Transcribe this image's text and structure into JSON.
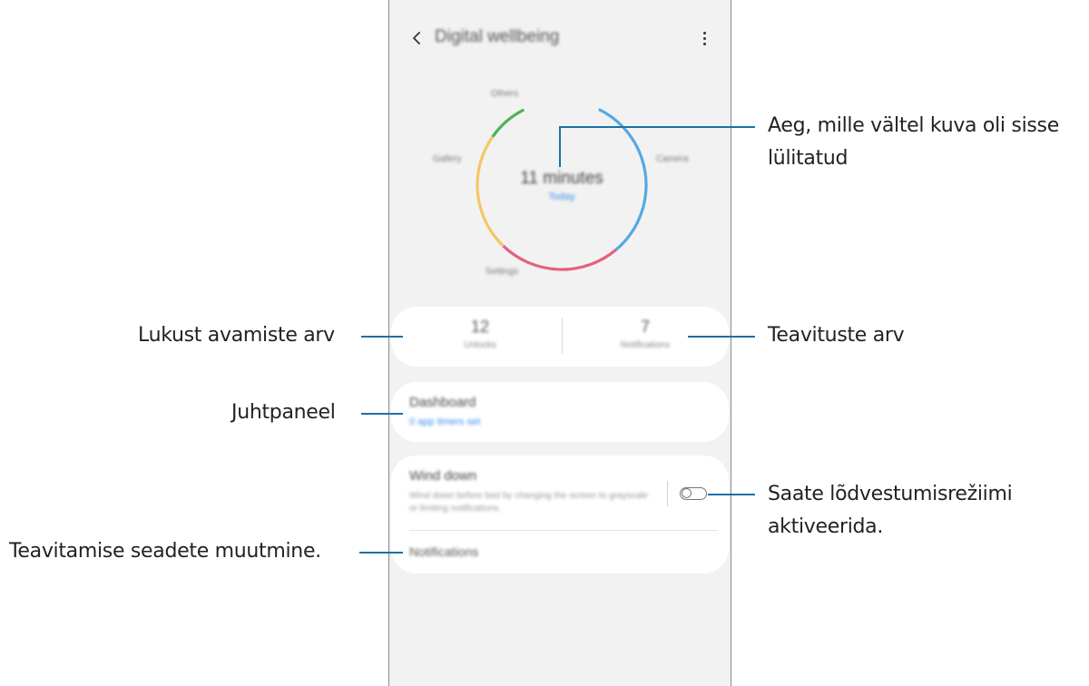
{
  "app": {
    "title": "Digital wellbeing",
    "back_icon": "back-arrow-icon",
    "more_icon": "more-vert-icon"
  },
  "screen_time": {
    "value": "11 minutes",
    "sublabel": "Today",
    "labels": {
      "top": "Others",
      "left": "Gallery",
      "right": "Camera",
      "bottom": "Settings"
    },
    "segment_colors": [
      "#55a8e3",
      "#e5607e",
      "#f2c866",
      "#4db35a"
    ]
  },
  "stats": {
    "unlocks_value": "12",
    "unlocks_label": "Unlocks",
    "notifications_value": "7",
    "notifications_label": "Notifications"
  },
  "dashboard": {
    "title": "Dashboard",
    "subtitle": "0 app timers set"
  },
  "wind_down": {
    "title": "Wind down",
    "description": "Wind down before bed by changing the screen to grayscale or limiting notifications.",
    "toggle_on": false
  },
  "notifications_item": {
    "label": "Notifications"
  },
  "callouts": {
    "screen_time_line1": "Aeg, mille vältel kuva oli sisse",
    "screen_time_line2": "lülitatud",
    "unlocks": "Lukust avamiste arv",
    "notifications_count": "Teavituste arv",
    "dashboard": "Juhtpaneel",
    "wind_down_line1": "Saate lõdvestumisrežiimi",
    "wind_down_line2": "aktiveerida.",
    "notification_settings": "Teavitamise seadete muutmine."
  },
  "colors": {
    "accent": "#3b8ee8",
    "leader_line": "#1e6fa8"
  }
}
